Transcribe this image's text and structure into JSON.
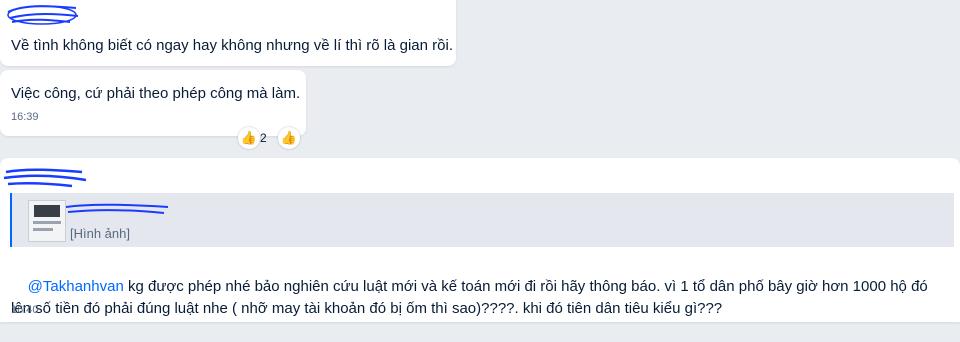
{
  "messages": [
    {
      "text": "Về tình không biết có ngay hay không nhưng về lí thì rõ là gian rồi."
    },
    {
      "text": "Việc công, cứ phải theo phép công mà làm.",
      "time": "16:39",
      "reaction_count": "2",
      "reaction_icon": "thumbs-up-icon"
    },
    {
      "quote_label": "[Hình ảnh]",
      "mention": "@Takhanhvan",
      "text": " kg được phép nhé bảo nghiên cứu luật mới và kế toán mới đi rồi hãy thông báo. vì 1 tổ dân phố bây giờ hơn 1000 hộ đó lên số tiền đó phải đúng luật nhe ( nhỡ may tài khoản đó bị ốm thì sao)????. khi đó tiên dân tiêu kiểu gì???",
      "time": "16:40"
    }
  ],
  "colors": {
    "background": "#e9ecf1",
    "bubble": "#ffffff",
    "mention": "#0068ff",
    "scribble": "#1a3cff",
    "quote_bar": "#0068ff"
  }
}
